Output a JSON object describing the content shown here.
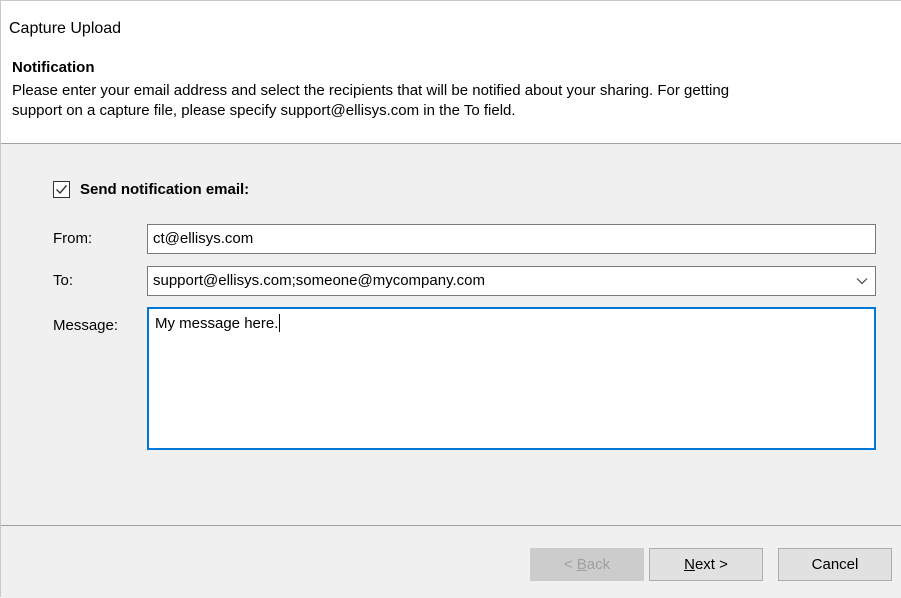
{
  "window": {
    "title": "Capture Upload"
  },
  "header": {
    "heading": "Notification",
    "description_line1": "Please enter your email address and select the recipients that will be notified about your sharing.  For getting",
    "description_line2": "support on a capture file, please specify support@ellisys.com in the To field."
  },
  "form": {
    "send_notification": {
      "label": "Send notification email:",
      "checked": true
    },
    "from": {
      "label": "From:",
      "value": "ct@ellisys.com"
    },
    "to": {
      "label": "To:",
      "value": "support@ellisys.com;someone@mycompany.com"
    },
    "message": {
      "label": "Message:",
      "value": "My message here."
    }
  },
  "buttons": {
    "back": {
      "prefix": "< ",
      "accel": "B",
      "rest": "ack",
      "enabled": false
    },
    "next": {
      "accel": "N",
      "rest": "ext >",
      "enabled": true
    },
    "cancel": {
      "label": "Cancel",
      "enabled": true
    }
  },
  "colors": {
    "focus_border": "#0078d7",
    "panel_background": "#f0f0f0",
    "button_face": "#e1e1e1"
  },
  "icons": {
    "checkbox_check": "check-mark-icon",
    "combo_dropdown": "chevron-down-icon"
  }
}
